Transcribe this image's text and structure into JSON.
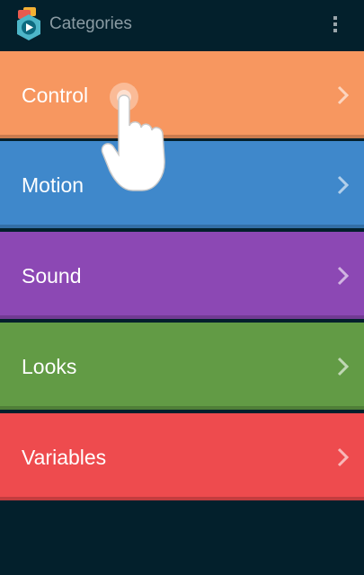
{
  "action_bar": {
    "title": "Categories",
    "icon": "app-logo-icon",
    "menu_icon": "overflow-menu-icon"
  },
  "categories": [
    {
      "label": "Control",
      "color": "#f79760",
      "icon": "chevron-right-icon"
    },
    {
      "label": "Motion",
      "color": "#3f88cb",
      "icon": "chevron-right-icon"
    },
    {
      "label": "Sound",
      "color": "#8c48b4",
      "icon": "chevron-right-icon"
    },
    {
      "label": "Looks",
      "color": "#629b45",
      "icon": "chevron-right-icon"
    },
    {
      "label": "Variables",
      "color": "#ee4b4e",
      "icon": "chevron-right-icon"
    }
  ],
  "colors": {
    "background": "#03202c",
    "title_text": "#8a9ba3",
    "row_text": "#ffffff"
  },
  "overlay": {
    "icon": "tap-hand-icon"
  }
}
